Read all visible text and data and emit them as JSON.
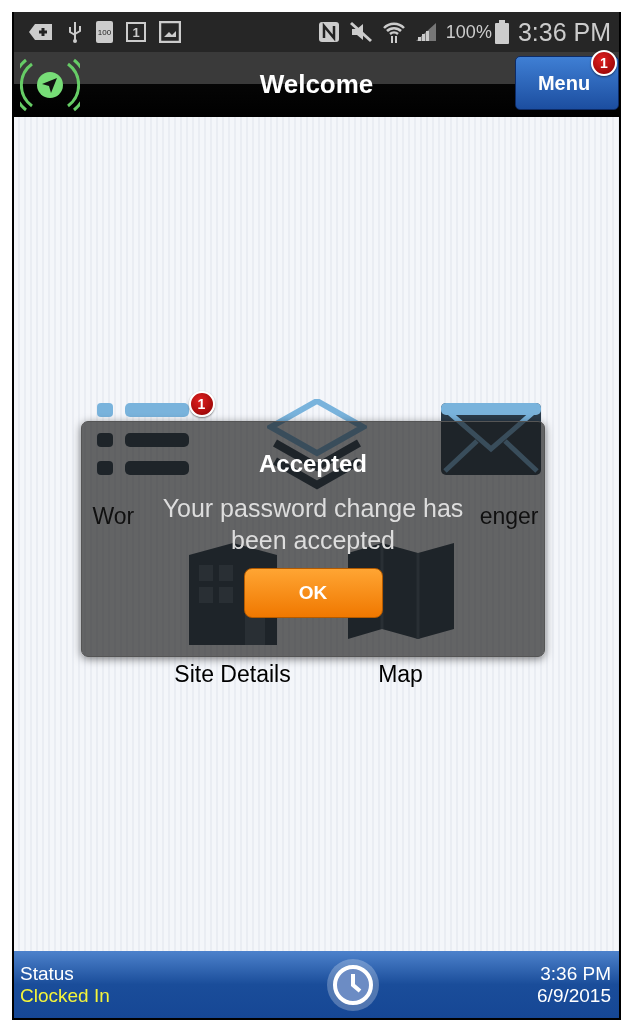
{
  "status_bar": {
    "battery_icon_label": "100",
    "calendar_icon_label": "1",
    "battery_percent": "100%",
    "time": "3:36 PM"
  },
  "app_bar": {
    "title": "Welcome",
    "menu_button": {
      "label": "Menu",
      "badge": "1"
    }
  },
  "tiles": [
    {
      "kind": "list",
      "label": "Wor",
      "badge": "1"
    },
    {
      "kind": "layers"
    },
    {
      "kind": "envelope",
      "label": "enger"
    },
    {
      "kind": "building",
      "label": "Site Details"
    },
    {
      "kind": "map",
      "label": "Map"
    }
  ],
  "dialog": {
    "title": "Accepted",
    "message": "Your password change has been accepted",
    "button": "OK"
  },
  "footer": {
    "status_label": "Status",
    "status_value": "Clocked In",
    "time": "3:36 PM",
    "date": "6/9/2015"
  }
}
